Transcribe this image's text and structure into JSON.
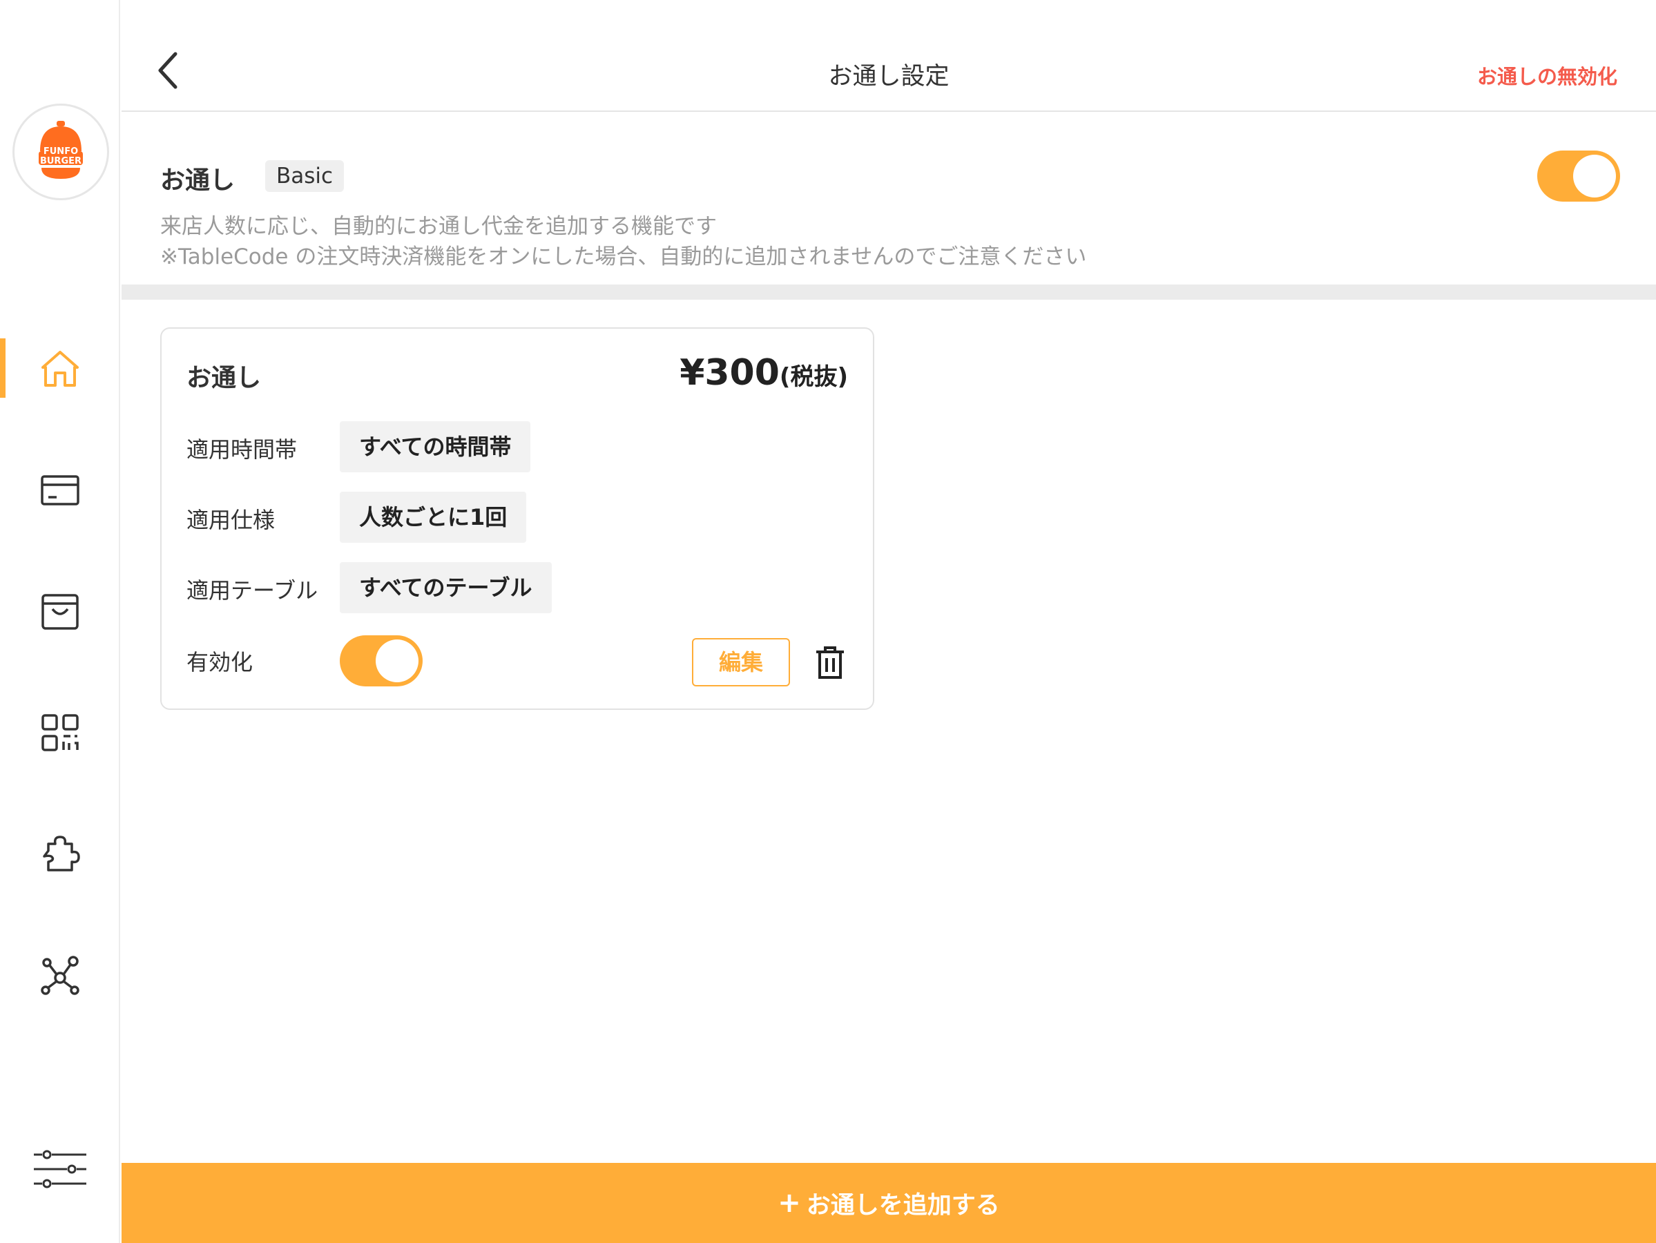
{
  "colors": {
    "accent": "#ffad38",
    "danger": "#f45b4c"
  },
  "sidebar": {
    "logo": {
      "line1": "FUNFO",
      "line2": "BURGER"
    },
    "items": [
      {
        "icon": "home-icon",
        "active": true
      },
      {
        "icon": "card-icon",
        "active": false
      },
      {
        "icon": "shopping-bag-icon",
        "active": false
      },
      {
        "icon": "qr-code-icon",
        "active": false
      },
      {
        "icon": "puzzle-icon",
        "active": false
      },
      {
        "icon": "network-icon",
        "active": false
      },
      {
        "icon": "settings-sliders-icon",
        "active": false
      }
    ]
  },
  "header": {
    "title": "お通し設定",
    "disable_link": "お通しの無効化"
  },
  "basic": {
    "title": "お通し",
    "badge": "Basic",
    "enabled": true,
    "desc_line1": "来店人数に応じ、自動的にお通し代金を追加する機能です",
    "desc_line2": "※TableCode の注文時決済機能をオンにした場合、自動的に追加されませんのでご注意ください"
  },
  "card": {
    "title": "お通し",
    "price": "¥300",
    "price_suffix": "(税抜)",
    "rows": [
      {
        "label": "適用時間帯",
        "value": "すべての時間帯"
      },
      {
        "label": "適用仕様",
        "value": "人数ごとに1回"
      },
      {
        "label": "適用テーブル",
        "value": "すべてのテーブル"
      }
    ],
    "enable_label": "有効化",
    "enabled": true,
    "edit_label": "編集"
  },
  "add_button": {
    "plus": "+",
    "label": "お通しを追加する"
  }
}
